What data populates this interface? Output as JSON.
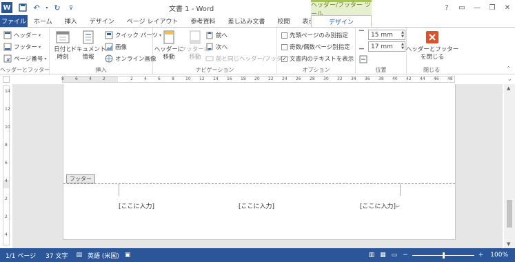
{
  "window": {
    "title": "文書 1 - Word",
    "context_tool_label": "ヘッダー/フッター ツール",
    "help_icon": "?",
    "accent": "#2b579a",
    "context_accent": "#a7c35c"
  },
  "tabs": [
    {
      "label": "ファイル"
    },
    {
      "label": "ホーム"
    },
    {
      "label": "挿入"
    },
    {
      "label": "デザイン"
    },
    {
      "label": "ページ レイアウト"
    },
    {
      "label": "参考資料"
    },
    {
      "label": "差し込み文書"
    },
    {
      "label": "校閲"
    },
    {
      "label": "表示"
    }
  ],
  "active_tab": {
    "label": "デザイン"
  },
  "ribbon": {
    "hf_group": {
      "header": "ヘッダー",
      "footer": "フッター",
      "page_number": "ページ番号",
      "label": "ヘッダーとフッター"
    },
    "insert_group": {
      "date_time": "日付と\n時刻",
      "doc_info": "ドキュメント\n情報",
      "quick_parts": "クイック パーツ",
      "picture": "画像",
      "online_picture": "オンライン画像",
      "label": "挿入"
    },
    "nav_group": {
      "go_to_header": "ヘッダーに\n移動",
      "go_to_footer": "フッターに\n移動",
      "previous": "前へ",
      "next": "次へ",
      "link_previous": "前と同じヘッダー/フッター",
      "label": "ナビゲーション"
    },
    "options_group": {
      "different_first": "先頭ページのみ別指定",
      "different_odd_even": "奇数/偶数ページ別指定",
      "show_doc_text": "文書内のテキストを表示",
      "show_doc_text_checked": true,
      "label": "オプション"
    },
    "position_group": {
      "header_from_top": "15 mm",
      "footer_from_bottom": "17 mm",
      "label": "位置"
    },
    "close_group": {
      "close": "ヘッダーとフッター\nを閉じる",
      "label": "閉じる"
    }
  },
  "ruler": {
    "h_numbers": [
      "8",
      "6",
      "4",
      "2",
      "",
      "2",
      "4",
      "6",
      "8",
      "10",
      "12",
      "14",
      "16",
      "18",
      "20",
      "22",
      "24",
      "26",
      "28",
      "30",
      "32",
      "34",
      "36",
      "38",
      "40",
      "42",
      "44",
      "46",
      "48"
    ],
    "v_numbers": [
      "14",
      "12",
      "10",
      "8",
      "6",
      "4",
      "2",
      "2",
      "4"
    ]
  },
  "document": {
    "footer_tag": "フッター",
    "placeholders": [
      "[ここに入力]",
      "[ここに入力]",
      "[ここに入力]"
    ],
    "paragraph_mark": "↵"
  },
  "status": {
    "page": "1/1 ページ",
    "words": "37 文字",
    "language": "英語 (米国)",
    "zoom": "100%"
  }
}
